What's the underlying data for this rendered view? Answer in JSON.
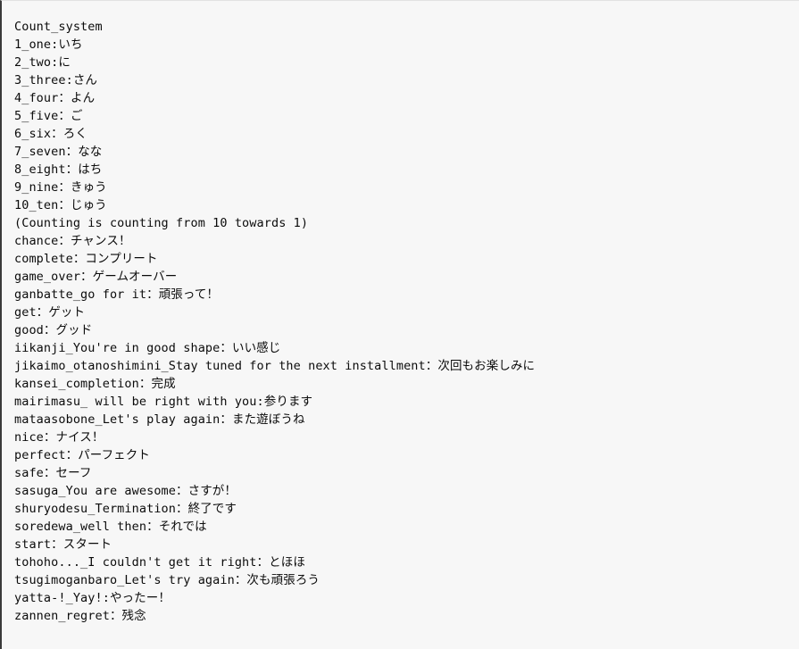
{
  "document": {
    "title": "Count_system",
    "background_color": "#f7f7f7",
    "text_color": "#0b0b0b",
    "lines": [
      "Count_system",
      "1_one:いち",
      "2_two:に",
      "3_three:さん",
      "4_four：よん",
      "5_five：ご",
      "6_six：ろく",
      "7_seven：なな",
      "8_eight：はち",
      "9_nine：きゅう",
      "10_ten：じゅう",
      "(Counting is counting from 10 towards 1)",
      "chance：チャンス！",
      "complete：コンプリート",
      "game_over：ゲームオーバー",
      "ganbatte_go for it：頑張って！",
      "get：ゲット",
      "good：グッド",
      "iikanji_You're in good shape：いい感じ",
      "jikaimo_otanoshimini_Stay tuned for the next installment：次回もお楽しみに",
      "kansei_completion：完成",
      "mairimasu_ will be right with you:参ります",
      "mataasobone_Let's play again：また遊ぼうね",
      "nice：ナイス！",
      "perfect：パーフェクト",
      "safe：セーフ",
      "sasuga_You are awesome：さすが！",
      "shuryodesu_Termination：終了です",
      "soredewa_well then：それでは",
      "start：スタート",
      "tohoho..._I couldn't get it right：とほほ",
      "tsugimoganbaro_Let's try again：次も頑張ろう",
      "yatta-!_Yay!:やったー！",
      "zannen_regret：残念"
    ]
  }
}
